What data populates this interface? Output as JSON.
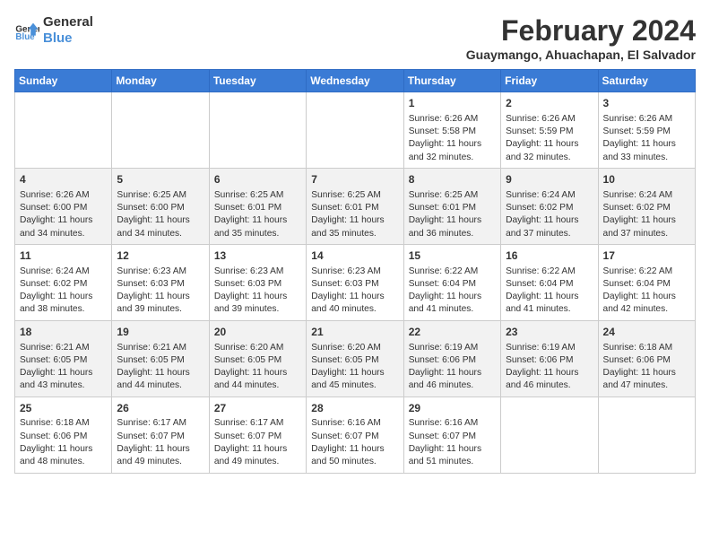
{
  "logo": {
    "line1": "General",
    "line2": "Blue"
  },
  "title": "February 2024",
  "location": "Guaymango, Ahuachapan, El Salvador",
  "days_of_week": [
    "Sunday",
    "Monday",
    "Tuesday",
    "Wednesday",
    "Thursday",
    "Friday",
    "Saturday"
  ],
  "weeks": [
    [
      {
        "day": "",
        "content": ""
      },
      {
        "day": "",
        "content": ""
      },
      {
        "day": "",
        "content": ""
      },
      {
        "day": "",
        "content": ""
      },
      {
        "day": "1",
        "content": "Sunrise: 6:26 AM\nSunset: 5:58 PM\nDaylight: 11 hours\nand 32 minutes."
      },
      {
        "day": "2",
        "content": "Sunrise: 6:26 AM\nSunset: 5:59 PM\nDaylight: 11 hours\nand 32 minutes."
      },
      {
        "day": "3",
        "content": "Sunrise: 6:26 AM\nSunset: 5:59 PM\nDaylight: 11 hours\nand 33 minutes."
      }
    ],
    [
      {
        "day": "4",
        "content": "Sunrise: 6:26 AM\nSunset: 6:00 PM\nDaylight: 11 hours\nand 34 minutes."
      },
      {
        "day": "5",
        "content": "Sunrise: 6:25 AM\nSunset: 6:00 PM\nDaylight: 11 hours\nand 34 minutes."
      },
      {
        "day": "6",
        "content": "Sunrise: 6:25 AM\nSunset: 6:01 PM\nDaylight: 11 hours\nand 35 minutes."
      },
      {
        "day": "7",
        "content": "Sunrise: 6:25 AM\nSunset: 6:01 PM\nDaylight: 11 hours\nand 35 minutes."
      },
      {
        "day": "8",
        "content": "Sunrise: 6:25 AM\nSunset: 6:01 PM\nDaylight: 11 hours\nand 36 minutes."
      },
      {
        "day": "9",
        "content": "Sunrise: 6:24 AM\nSunset: 6:02 PM\nDaylight: 11 hours\nand 37 minutes."
      },
      {
        "day": "10",
        "content": "Sunrise: 6:24 AM\nSunset: 6:02 PM\nDaylight: 11 hours\nand 37 minutes."
      }
    ],
    [
      {
        "day": "11",
        "content": "Sunrise: 6:24 AM\nSunset: 6:02 PM\nDaylight: 11 hours\nand 38 minutes."
      },
      {
        "day": "12",
        "content": "Sunrise: 6:23 AM\nSunset: 6:03 PM\nDaylight: 11 hours\nand 39 minutes."
      },
      {
        "day": "13",
        "content": "Sunrise: 6:23 AM\nSunset: 6:03 PM\nDaylight: 11 hours\nand 39 minutes."
      },
      {
        "day": "14",
        "content": "Sunrise: 6:23 AM\nSunset: 6:03 PM\nDaylight: 11 hours\nand 40 minutes."
      },
      {
        "day": "15",
        "content": "Sunrise: 6:22 AM\nSunset: 6:04 PM\nDaylight: 11 hours\nand 41 minutes."
      },
      {
        "day": "16",
        "content": "Sunrise: 6:22 AM\nSunset: 6:04 PM\nDaylight: 11 hours\nand 41 minutes."
      },
      {
        "day": "17",
        "content": "Sunrise: 6:22 AM\nSunset: 6:04 PM\nDaylight: 11 hours\nand 42 minutes."
      }
    ],
    [
      {
        "day": "18",
        "content": "Sunrise: 6:21 AM\nSunset: 6:05 PM\nDaylight: 11 hours\nand 43 minutes."
      },
      {
        "day": "19",
        "content": "Sunrise: 6:21 AM\nSunset: 6:05 PM\nDaylight: 11 hours\nand 44 minutes."
      },
      {
        "day": "20",
        "content": "Sunrise: 6:20 AM\nSunset: 6:05 PM\nDaylight: 11 hours\nand 44 minutes."
      },
      {
        "day": "21",
        "content": "Sunrise: 6:20 AM\nSunset: 6:05 PM\nDaylight: 11 hours\nand 45 minutes."
      },
      {
        "day": "22",
        "content": "Sunrise: 6:19 AM\nSunset: 6:06 PM\nDaylight: 11 hours\nand 46 minutes."
      },
      {
        "day": "23",
        "content": "Sunrise: 6:19 AM\nSunset: 6:06 PM\nDaylight: 11 hours\nand 46 minutes."
      },
      {
        "day": "24",
        "content": "Sunrise: 6:18 AM\nSunset: 6:06 PM\nDaylight: 11 hours\nand 47 minutes."
      }
    ],
    [
      {
        "day": "25",
        "content": "Sunrise: 6:18 AM\nSunset: 6:06 PM\nDaylight: 11 hours\nand 48 minutes."
      },
      {
        "day": "26",
        "content": "Sunrise: 6:17 AM\nSunset: 6:07 PM\nDaylight: 11 hours\nand 49 minutes."
      },
      {
        "day": "27",
        "content": "Sunrise: 6:17 AM\nSunset: 6:07 PM\nDaylight: 11 hours\nand 49 minutes."
      },
      {
        "day": "28",
        "content": "Sunrise: 6:16 AM\nSunset: 6:07 PM\nDaylight: 11 hours\nand 50 minutes."
      },
      {
        "day": "29",
        "content": "Sunrise: 6:16 AM\nSunset: 6:07 PM\nDaylight: 11 hours\nand 51 minutes."
      },
      {
        "day": "",
        "content": ""
      },
      {
        "day": "",
        "content": ""
      }
    ]
  ]
}
